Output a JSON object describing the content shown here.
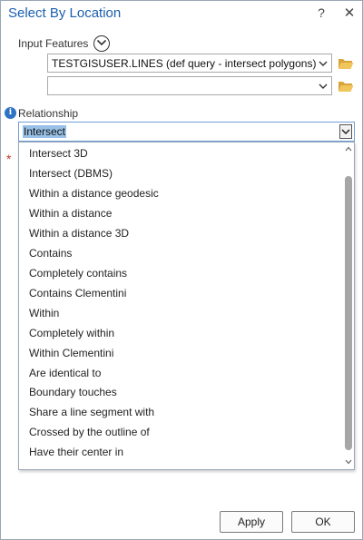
{
  "window": {
    "title": "Select By Location",
    "help_glyph": "?",
    "close_glyph": "✕"
  },
  "input_features": {
    "label": "Input Features",
    "expand_icon": "chevron-down-circle-icon",
    "rows": [
      {
        "value": "TESTGISUSER.LINES (def query - intersect polygons)",
        "icon": "folder-open-icon"
      },
      {
        "value": "",
        "icon": "folder-open-icon"
      }
    ]
  },
  "relationship": {
    "label": "Relationship",
    "selected": "Intersect",
    "info_glyph": "i",
    "required_marker": "*",
    "options": [
      "Intersect 3D",
      "Intersect (DBMS)",
      "Within a distance geodesic",
      "Within a distance",
      "Within a distance 3D",
      "Contains",
      "Completely contains",
      "Contains Clementini",
      "Within",
      "Completely within",
      "Within Clementini",
      "Are identical to",
      "Boundary touches",
      "Share a line segment with",
      "Crossed by the outline of",
      "Have their center in"
    ]
  },
  "footer": {
    "apply_label": "Apply",
    "ok_label": "OK"
  },
  "colors": {
    "title": "#1b5fae",
    "folder": "#e8b84a",
    "selection": "#99c1e8",
    "info": "#2e73c4",
    "required": "#c0392b"
  }
}
